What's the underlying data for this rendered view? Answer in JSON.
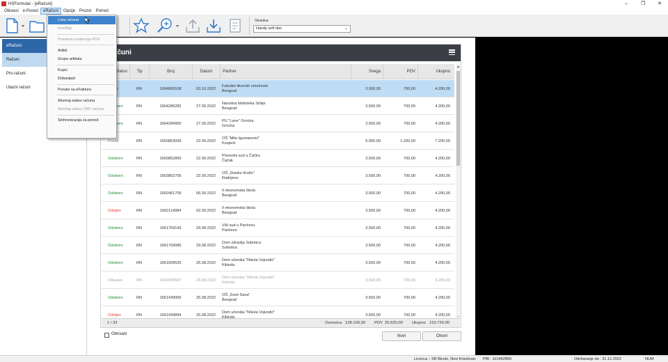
{
  "window": {
    "title": "HSFormular - [eRačuni]"
  },
  "menubar": [
    {
      "label": "Obrasci",
      "active": false
    },
    {
      "label": "e-Porezi",
      "active": false
    },
    {
      "label": "eRačuni",
      "active": true
    },
    {
      "label": "Opcije",
      "active": false
    },
    {
      "label": "Prozor",
      "active": false
    },
    {
      "label": "Pomoć",
      "active": false
    }
  ],
  "toolbar": {
    "page_label": "Stranka:",
    "page_value": "Handy soft doo"
  },
  "sidebar": {
    "items": [
      {
        "label": "eRačuni",
        "kind": "head"
      },
      {
        "label": "Računi",
        "kind": "sel"
      },
      {
        "label": "Pro-računi",
        "kind": ""
      },
      {
        "label": "Ulazni računi",
        "kind": ""
      }
    ]
  },
  "dropdown": {
    "items": [
      {
        "label": "Lista računa",
        "state": "hl"
      },
      {
        "label": "Izveštaji",
        "state": "dis"
      },
      {
        "sep": true
      },
      {
        "label": "Posebna evidencija PDV",
        "state": "dis"
      },
      {
        "sep": true
      },
      {
        "label": "Artikli",
        "state": ""
      },
      {
        "label": "Grupe artikala",
        "state": ""
      },
      {
        "sep": true
      },
      {
        "label": "Kupci",
        "state": ""
      },
      {
        "label": "Dobavljači",
        "state": ""
      },
      {
        "sep": true
      },
      {
        "label": "Poruke sa eFaktura",
        "state": ""
      },
      {
        "sep": true
      },
      {
        "label": "Ažuriraj status računa",
        "state": ""
      },
      {
        "label": "Ažuriraj status CRF računa",
        "state": "dis"
      },
      {
        "sep": true
      },
      {
        "label": "Sinhronizacija za period",
        "state": ""
      }
    ]
  },
  "panel": {
    "title": "eRačuni",
    "columns": [
      "Status",
      "Tip",
      "Broj",
      "Datum",
      "Partner",
      "Svega",
      "PDV",
      "Ukupno"
    ],
    "rows": [
      {
        "status": "Poslat",
        "st": "x",
        "tip": "RN",
        "broj": "1664809108",
        "datum": "03.10.2022",
        "p1": "Fakultet likovnih umetnosti",
        "p2": "Beograd",
        "svega": "3.500,00",
        "pdv": "700,00",
        "ukupno": "4.200,00",
        "sel": true,
        "dim": false
      },
      {
        "status": "Odobren",
        "st": "ok",
        "tip": "RN",
        "broj": "1664286282",
        "datum": "27.09.2022",
        "p1": "Narodna biblioteka Srbije",
        "p2": "Beograd",
        "svega": "3.500,00",
        "pdv": "700,00",
        "ukupno": "4.200,00",
        "sel": false,
        "dim": false
      },
      {
        "status": "Odobren",
        "st": "ok",
        "tip": "RN",
        "broj": "1664284950",
        "datum": "27.09.2022",
        "p1": "PU \"Lane\" Grocka",
        "p2": "Grocka",
        "svega": "3.500,00",
        "pdv": "700,00",
        "ukupno": "4.200,00",
        "sel": false,
        "dim": false
      },
      {
        "status": "Poslat",
        "st": "x",
        "tip": "RN",
        "broj": "1663853099",
        "datum": "22.09.2022",
        "p1": "OŠ \"Mito Igumanović\"",
        "p2": "Kosjerić",
        "svega": "6.000,00",
        "pdv": "1.200,00",
        "ukupno": "7.200,00",
        "sel": false,
        "dim": false
      },
      {
        "status": "Odobren",
        "st": "ok",
        "tip": "RN",
        "broj": "1663852850",
        "datum": "22.09.2022",
        "p1": "Privredni sud u Čačku",
        "p2": "Čačak",
        "svega": "3.500,00",
        "pdv": "700,00",
        "ukupno": "4.200,00",
        "sel": false,
        "dim": false
      },
      {
        "status": "Odobren",
        "st": "ok",
        "tip": "RN",
        "broj": "1663852706",
        "datum": "22.09.2022",
        "p1": "OŠ „Stanko Krstin\"",
        "p2": "Radojevo",
        "svega": "3.500,00",
        "pdv": "700,00",
        "ukupno": "4.200,00",
        "sel": false,
        "dim": false
      },
      {
        "status": "Odobren",
        "st": "ok",
        "tip": "RN",
        "broj": "1662461709",
        "datum": "06.09.2022",
        "p1": "II ekonomska škola",
        "p2": "Beograd",
        "svega": "3.500,00",
        "pdv": "700,00",
        "ukupno": "4.200,00",
        "sel": false,
        "dim": false
      },
      {
        "status": "Odbijen",
        "st": "no",
        "tip": "RN",
        "broj": "1662114084",
        "datum": "02.09.2022",
        "p1": "II ekonomska škola",
        "p2": "Beograd",
        "svega": "3.500,00",
        "pdv": "700,00",
        "ukupno": "4.200,00",
        "sel": false,
        "dim": false
      },
      {
        "status": "Odobren",
        "st": "ok",
        "tip": "RN",
        "broj": "1661769143",
        "datum": "29.08.2022",
        "p1": "Viši sud u Pančevu",
        "p2": "Pančevo",
        "svega": "3.500,00",
        "pdv": "700,00",
        "ukupno": "4.200,00",
        "sel": false,
        "dim": false
      },
      {
        "status": "Odobren",
        "st": "ok",
        "tip": "RN",
        "broj": "1661769085",
        "datum": "29.08.2022",
        "p1": "Dom zdravlja Subotica",
        "p2": "Subotica",
        "svega": "3.500,00",
        "pdv": "700,00",
        "ukupno": "4.200,00",
        "sel": false,
        "dim": false
      },
      {
        "status": "Odobren",
        "st": "ok",
        "tip": "RN",
        "broj": "1661509525",
        "datum": "26.08.2022",
        "p1": "Dom učenika \"Nikola Vojvodić\"",
        "p2": "Kikinda",
        "svega": "3.500,00",
        "pdv": "700,00",
        "ukupno": "4.200,00",
        "sel": false,
        "dim": false
      },
      {
        "status": "Otkazan",
        "st": "x",
        "tip": "RN",
        "broj": "1661509507",
        "datum": "26.08.2022",
        "p1": "Dom učenika \"Nikola Vojvodić\"",
        "p2": "Kikinda",
        "svega": "3.500,00",
        "pdv": "700,00",
        "ukupno": "4.200,00",
        "sel": false,
        "dim": true
      },
      {
        "status": "Odobren",
        "st": "ok",
        "tip": "RN",
        "broj": "1661439956",
        "datum": "25.08.2022",
        "p1": "OŠ „Sveti Sava\"",
        "p2": "Beograd",
        "svega": "3.500,00",
        "pdv": "700,00",
        "ukupno": "4.200,00",
        "sel": false,
        "dim": false
      },
      {
        "status": "Odbijen",
        "st": "no",
        "tip": "RN",
        "broj": "1661439894",
        "datum": "25.08.2022",
        "p1": "Dom učenika \"Nikola Vojvodić\"",
        "p2": "Kikinda",
        "svega": "3.500,00",
        "pdv": "700,00",
        "ukupno": "4.200,00",
        "sel": false,
        "dim": false
      }
    ],
    "footer": {
      "count": "1 / 33",
      "osnovica_label": "Osnovica",
      "osnovica": "128.100,00",
      "pdv_label": "PDV",
      "pdv": "25.620,00",
      "ukupno_label": "Ukupno",
      "ukupno": "153.720,00"
    }
  },
  "bottom": {
    "obrisani": "Obrisani",
    "novi": "Novi",
    "otvori": "Otvori"
  },
  "statusbar": {
    "licence": "Licenca :: SR Bicolo, Novi Kneževac",
    "pib": "PIB : 101462869",
    "valid": "Održavanje do : 31.12.2022",
    "num": "NUM"
  },
  "colors": {
    "accent": "#2d67a8",
    "grid_selected": "#bfdcf5",
    "approved": "#1f8a2e",
    "rejected": "#e04b3e"
  },
  "icons": [
    "new-document-icon",
    "open-folder-icon",
    "star-icon",
    "zoom-icon",
    "upload-icon",
    "download-icon",
    "print-icon"
  ]
}
